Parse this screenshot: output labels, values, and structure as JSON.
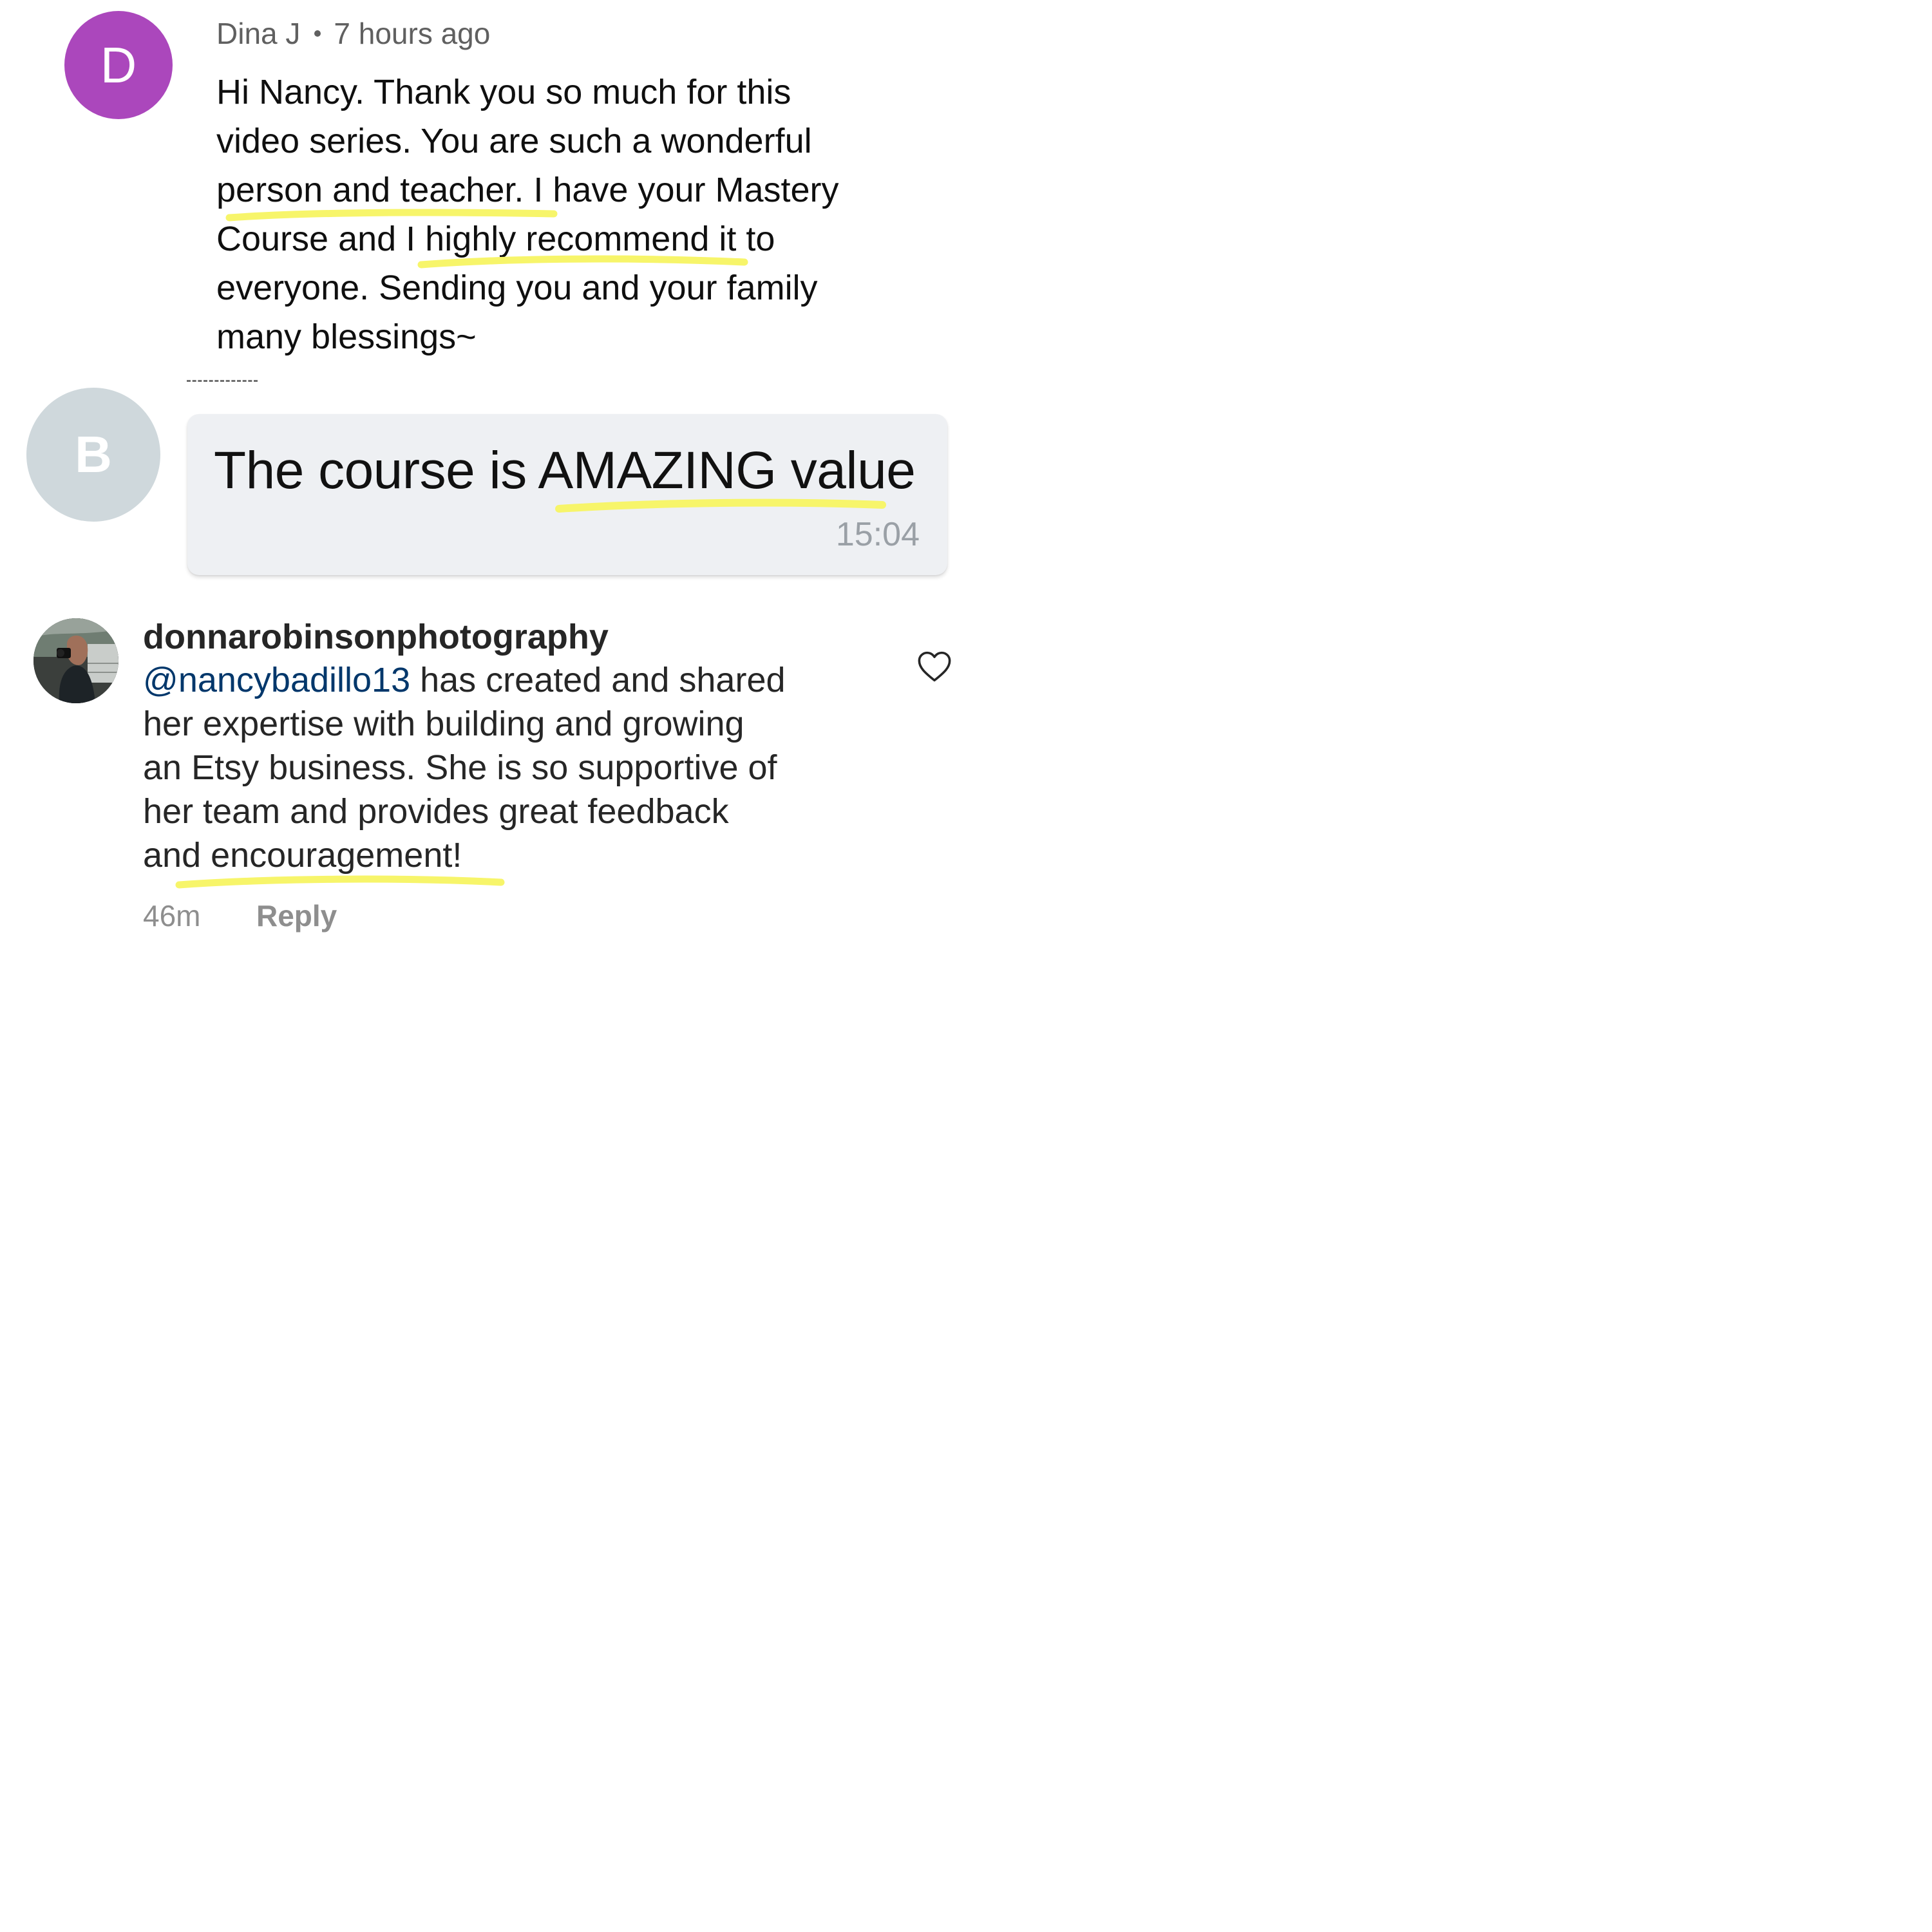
{
  "comment_1": {
    "avatar_letter": "D",
    "avatar_color": "#ab47bc",
    "author": "Dina J",
    "time": "7 hours ago",
    "lines": [
      "Hi Nancy. Thank you so much for this",
      "video series. You are such a wonderful",
      "person and teacher. I have your Mastery",
      "Course and I highly recommend it to",
      "everyone. Sending you and your family",
      "many blessings~"
    ]
  },
  "message": {
    "avatar_letter": "B",
    "avatar_color": "#cfd8dc",
    "text": "The course is AMAZING value",
    "time": "15:04"
  },
  "comment_3": {
    "username": "donnarobinsonphotography",
    "mention": "@nancybadillo13",
    "line_1_rest": " has created and shared",
    "lines": [
      "her expertise with building and growing",
      "an Etsy business. She is so supportive of",
      "her team and provides great feedback",
      "and encouragement!"
    ],
    "age": "46m",
    "reply_label": "Reply",
    "like_icon": "heart-outline-icon"
  },
  "highlight_color": "#f7f56a"
}
